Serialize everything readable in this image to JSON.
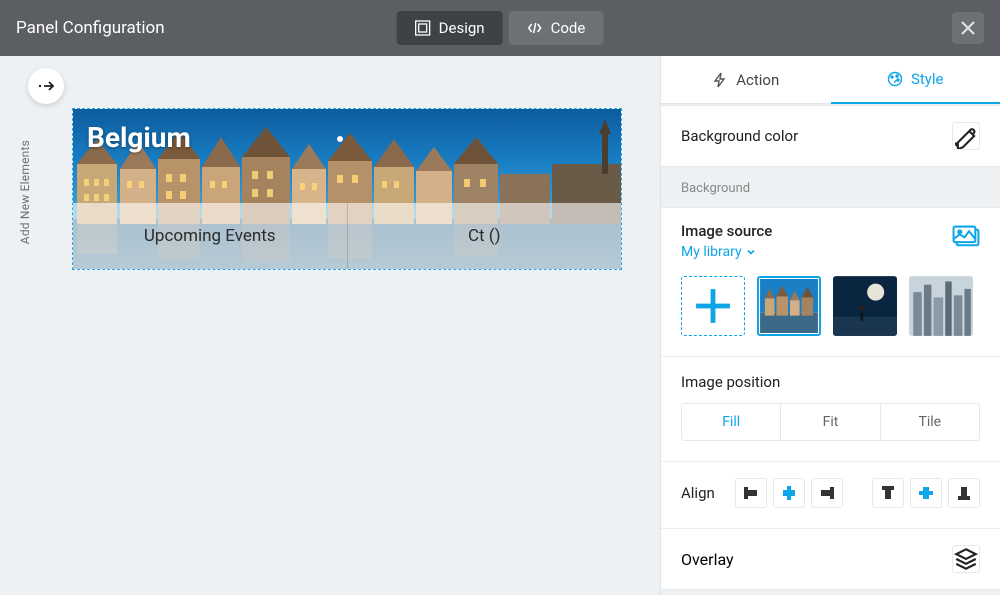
{
  "header": {
    "title": "Panel Configuration",
    "tabs": {
      "design": "Design",
      "code": "Code"
    }
  },
  "leftRail": {
    "addNew": "Add New Elements"
  },
  "panel": {
    "title": "Belgium",
    "tabs": [
      "Upcoming Events",
      "Ct ()"
    ]
  },
  "side": {
    "tabs": {
      "action": "Action",
      "style": "Style"
    },
    "bgColor": "Background color",
    "bgSection": "Background",
    "imgSrc": {
      "label": "Image source",
      "link": "My library"
    },
    "imgPos": {
      "label": "Image position",
      "options": [
        "Fill",
        "Fit",
        "Tile"
      ],
      "active": 0
    },
    "align": {
      "label": "Align",
      "hActive": 1,
      "vActive": 1
    },
    "overlay": "Overlay"
  }
}
